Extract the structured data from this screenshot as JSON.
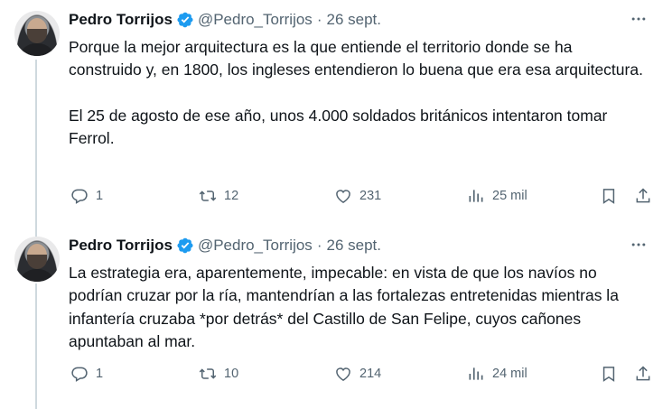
{
  "tweets": [
    {
      "author": {
        "name": "Pedro Torrijos",
        "handle": "@Pedro_Torrijos",
        "date": "26 sept."
      },
      "dot": "·",
      "text": "Porque la mejor arquitectura es la que entiende el territorio donde se ha construido y, en 1800, los ingleses entendieron lo buena que era esa arquitectura.\n\nEl 25 de agosto de ese año, unos 4.000 soldados británicos intentaron tomar Ferrol.",
      "stats": {
        "replies": "1",
        "retweets": "12",
        "likes": "231",
        "views": "25 mil"
      }
    },
    {
      "author": {
        "name": "Pedro Torrijos",
        "handle": "@Pedro_Torrijos",
        "date": "26 sept."
      },
      "dot": "·",
      "text": "La estrategia era, aparentemente, impecable: en vista de que los navíos no podrían cruzar por la ría, mantendrían a las fortalezas entretenidas mientras la infantería cruzaba *por detrás* del Castillo de San Felipe, cuyos cañones apuntaban al mar.",
      "stats": {
        "replies": "1",
        "retweets": "10",
        "likes": "214",
        "views": "24 mil"
      }
    }
  ],
  "colors": {
    "verified": "#1d9bf0",
    "muted": "#536471",
    "text": "#0f1419",
    "thread_line": "#cfd9de"
  },
  "icons": [
    "more-icon",
    "verified-badge-icon",
    "reply-icon",
    "retweet-icon",
    "like-icon",
    "views-icon",
    "bookmark-icon",
    "share-icon"
  ]
}
